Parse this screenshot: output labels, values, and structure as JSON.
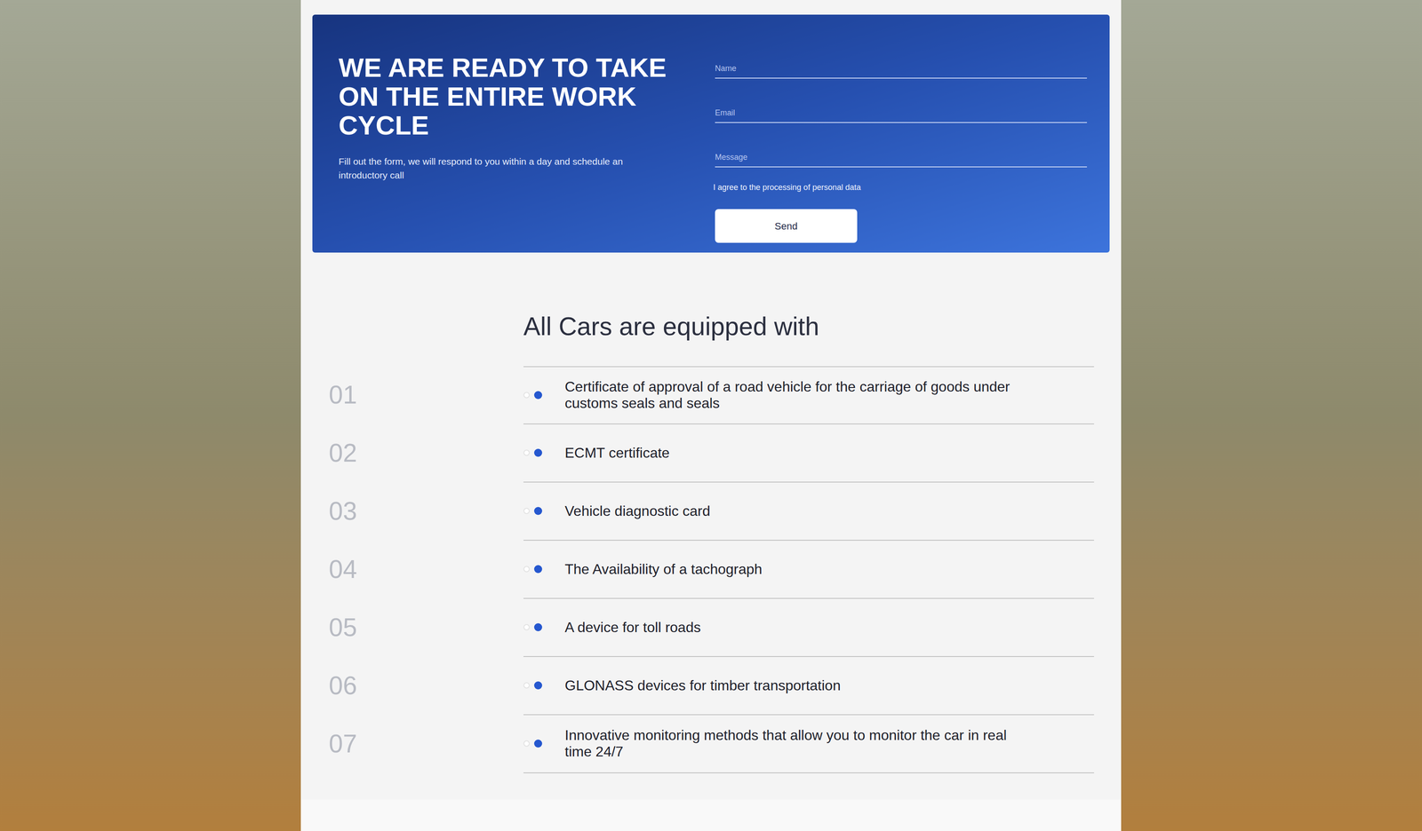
{
  "contact_form": {
    "title": "WE ARE READY TO TAKE ON THE ENTIRE WORK CYCLE",
    "subtitle": "Fill out the form, we will respond to you within a day and schedule an introductory call",
    "fields": [
      {
        "placeholder": "Name"
      },
      {
        "placeholder": "Email"
      },
      {
        "placeholder": "Message"
      }
    ],
    "consent": "I agree to the processing of personal data",
    "button": "Send"
  },
  "equipment": {
    "title": "All Cars are equipped with",
    "items": [
      {
        "number": "01",
        "text": "Certificate of approval of a road vehicle for the carriage of goods under customs seals and seals"
      },
      {
        "number": "02",
        "text": "ECMT certificate"
      },
      {
        "number": "03",
        "text": "Vehicle diagnostic card"
      },
      {
        "number": "04",
        "text": "The Availability of a tachograph"
      },
      {
        "number": "05",
        "text": "A device for toll roads"
      },
      {
        "number": "06",
        "text": "GLONASS devices for timber transportation"
      },
      {
        "number": "07",
        "text": "Innovative monitoring methods that allow you to monitor the car in real time 24/7"
      }
    ]
  }
}
